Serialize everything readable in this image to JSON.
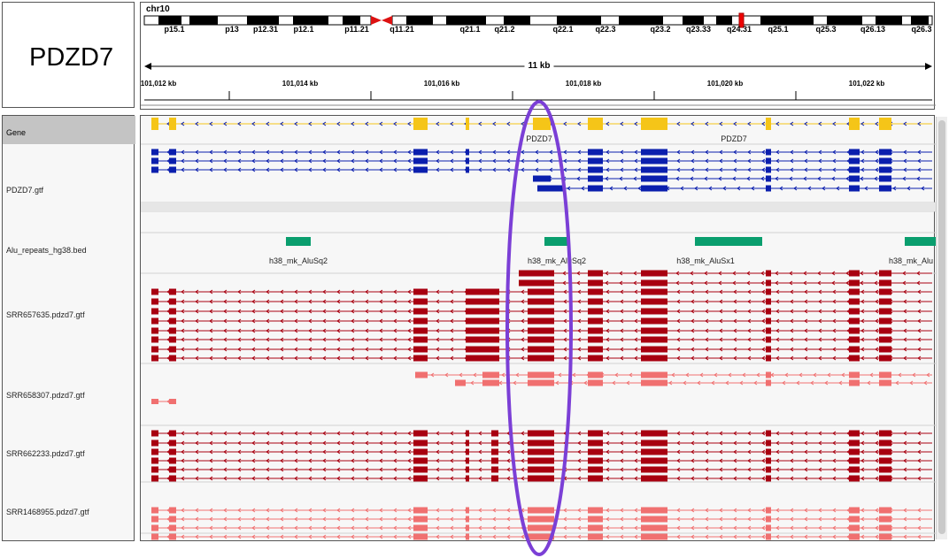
{
  "gene_title": "PDZD7",
  "chromosome": "chr10",
  "bands": [
    "p15.1",
    "p13",
    "p12.31",
    "p12.1",
    "p11.21",
    "q11.21",
    "q21.1",
    "q21.2",
    "q22.1",
    "q22.3",
    "q23.2",
    "q23.33",
    "q24.31",
    "q25.1",
    "q25.3",
    "q26.13",
    "q26.3"
  ],
  "span_label": "11 kb",
  "positions": [
    "101,012 kb",
    "101,014 kb",
    "101,016 kb",
    "101,018 kb",
    "101,020 kb",
    "101,022 kb"
  ],
  "tracks": {
    "gene": "Gene",
    "gtf": "PDZD7.gtf",
    "alu": "Alu_repeats_hg38.bed",
    "srr1": "SRR657635.pdzd7.gtf",
    "srr2": "SRR658307.pdzd7.gtf",
    "srr3": "SRR662233.pdzd7.gtf",
    "srr4": "SRR1468955.pdzd7.gtf"
  },
  "gene_labels": [
    "PDZD7",
    "PDZD7"
  ],
  "alu_labels": [
    "h38_mk_AluSq2",
    "h38_mk_AluSq2",
    "h38_mk_AluSx1",
    "h38_mk_Alu"
  ],
  "colors": {
    "gene": "#f5c518",
    "gtf": "#0b1fae",
    "alu": "#0a9e6e",
    "dark_red": "#a80010",
    "light_red": "#f07070",
    "highlight": "#7b3fd6",
    "centromere": "#dd1111"
  }
}
